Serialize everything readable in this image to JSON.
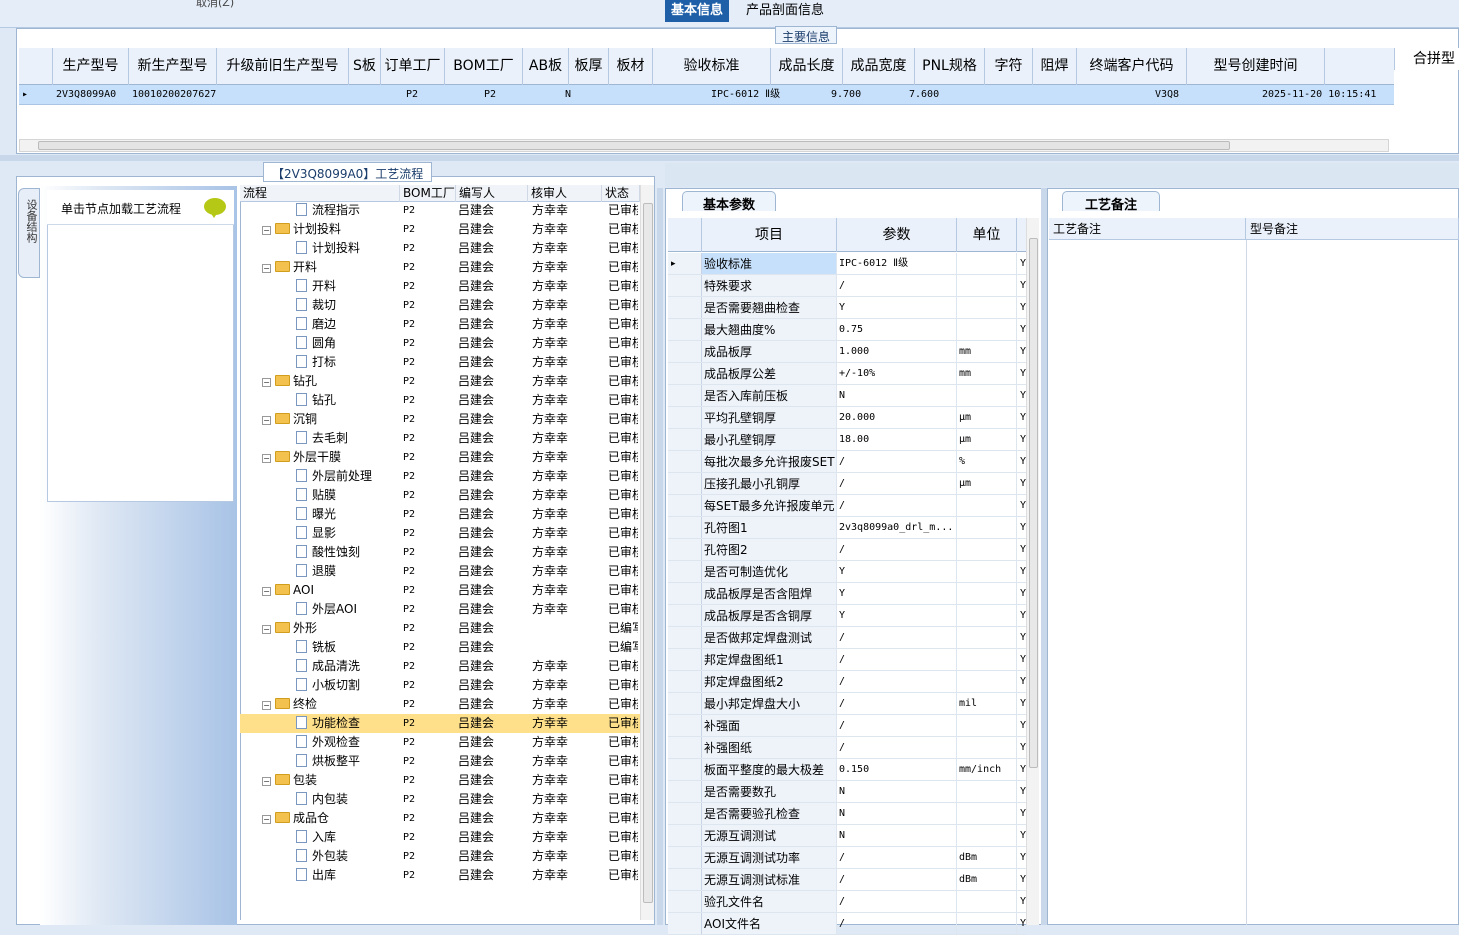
{
  "top": {
    "cut_label": "取消(Z)"
  },
  "main_info": {
    "title": "主要信息",
    "columns": [
      "生产型号",
      "新生产型号",
      "升级前旧生产型号",
      "S板",
      "订单工厂",
      "BOM工厂",
      "AB板",
      "板厚",
      "板材",
      "验收标准",
      "成品长度",
      "成品宽度",
      "PNL规格",
      "字符",
      "阻焊",
      "终端客户代码",
      "型号创建时间"
    ],
    "row": {
      "prod_model": "2V3Q8099A0",
      "new_model": "10010200207627",
      "order_factory": "P2",
      "bom_factory": "P2",
      "ab_board": "N",
      "accept_std": "IPC-6012 Ⅱ级",
      "length": "9.700",
      "width": "7.600",
      "customer_code": "V3Q8",
      "created": "2025-11-20 10:15:41"
    },
    "merge_tab": "合拼型"
  },
  "process": {
    "title": "【2V3Q8099A0】工艺流程",
    "vtab": "设备结构",
    "load_hint": "单击节点加载工艺流程",
    "columns": [
      "流程",
      "BOM工厂",
      "编写人",
      "核审人",
      "状态"
    ],
    "rows": [
      {
        "name": "流程指示",
        "level": 2,
        "bom": "P2",
        "writer": "吕建会",
        "reviewer": "方幸幸",
        "status": "已审核"
      },
      {
        "name": "计划投料",
        "level": 1,
        "bom": "P2",
        "writer": "吕建会",
        "reviewer": "方幸幸",
        "status": "已审核"
      },
      {
        "name": "计划投料",
        "level": 2,
        "bom": "P2",
        "writer": "吕建会",
        "reviewer": "方幸幸",
        "status": "已审核"
      },
      {
        "name": "开料",
        "level": 1,
        "bom": "P2",
        "writer": "吕建会",
        "reviewer": "方幸幸",
        "status": "已审核"
      },
      {
        "name": "开料",
        "level": 2,
        "bom": "P2",
        "writer": "吕建会",
        "reviewer": "方幸幸",
        "status": "已审核"
      },
      {
        "name": "裁切",
        "level": 2,
        "bom": "P2",
        "writer": "吕建会",
        "reviewer": "方幸幸",
        "status": "已审核"
      },
      {
        "name": "磨边",
        "level": 2,
        "bom": "P2",
        "writer": "吕建会",
        "reviewer": "方幸幸",
        "status": "已审核"
      },
      {
        "name": "圆角",
        "level": 2,
        "bom": "P2",
        "writer": "吕建会",
        "reviewer": "方幸幸",
        "status": "已审核"
      },
      {
        "name": "打标",
        "level": 2,
        "bom": "P2",
        "writer": "吕建会",
        "reviewer": "方幸幸",
        "status": "已审核"
      },
      {
        "name": "钻孔",
        "level": 1,
        "bom": "P2",
        "writer": "吕建会",
        "reviewer": "方幸幸",
        "status": "已审核"
      },
      {
        "name": "钻孔",
        "level": 2,
        "bom": "P2",
        "writer": "吕建会",
        "reviewer": "方幸幸",
        "status": "已审核"
      },
      {
        "name": "沉铜",
        "level": 1,
        "bom": "P2",
        "writer": "吕建会",
        "reviewer": "方幸幸",
        "status": "已审核"
      },
      {
        "name": "去毛刺",
        "level": 2,
        "bom": "P2",
        "writer": "吕建会",
        "reviewer": "方幸幸",
        "status": "已审核"
      },
      {
        "name": "外层干膜",
        "level": 1,
        "bom": "P2",
        "writer": "吕建会",
        "reviewer": "方幸幸",
        "status": "已审核"
      },
      {
        "name": "外层前处理",
        "level": 2,
        "bom": "P2",
        "writer": "吕建会",
        "reviewer": "方幸幸",
        "status": "已审核"
      },
      {
        "name": "贴膜",
        "level": 2,
        "bom": "P2",
        "writer": "吕建会",
        "reviewer": "方幸幸",
        "status": "已审核"
      },
      {
        "name": "曝光",
        "level": 2,
        "bom": "P2",
        "writer": "吕建会",
        "reviewer": "方幸幸",
        "status": "已审核"
      },
      {
        "name": "显影",
        "level": 2,
        "bom": "P2",
        "writer": "吕建会",
        "reviewer": "方幸幸",
        "status": "已审核"
      },
      {
        "name": "酸性蚀刻",
        "level": 2,
        "bom": "P2",
        "writer": "吕建会",
        "reviewer": "方幸幸",
        "status": "已审核"
      },
      {
        "name": "退膜",
        "level": 2,
        "bom": "P2",
        "writer": "吕建会",
        "reviewer": "方幸幸",
        "status": "已审核"
      },
      {
        "name": "AOI",
        "level": 1,
        "bom": "P2",
        "writer": "吕建会",
        "reviewer": "方幸幸",
        "status": "已审核"
      },
      {
        "name": "外层AOI",
        "level": 2,
        "bom": "P2",
        "writer": "吕建会",
        "reviewer": "方幸幸",
        "status": "已审核"
      },
      {
        "name": "外形",
        "level": 1,
        "bom": "P2",
        "writer": "吕建会",
        "reviewer": "",
        "status": "已编写"
      },
      {
        "name": "铣板",
        "level": 2,
        "bom": "P2",
        "writer": "吕建会",
        "reviewer": "",
        "status": "已编写"
      },
      {
        "name": "成品清洗",
        "level": 2,
        "bom": "P2",
        "writer": "吕建会",
        "reviewer": "方幸幸",
        "status": "已审核"
      },
      {
        "name": "小板切割",
        "level": 2,
        "bom": "P2",
        "writer": "吕建会",
        "reviewer": "方幸幸",
        "status": "已审核"
      },
      {
        "name": "终检",
        "level": 1,
        "bom": "P2",
        "writer": "吕建会",
        "reviewer": "方幸幸",
        "status": "已审核"
      },
      {
        "name": "功能检查",
        "level": 2,
        "bom": "P2",
        "writer": "吕建会",
        "reviewer": "方幸幸",
        "status": "已审核",
        "selected": true
      },
      {
        "name": "外观检查",
        "level": 2,
        "bom": "P2",
        "writer": "吕建会",
        "reviewer": "方幸幸",
        "status": "已审核"
      },
      {
        "name": "烘板整平",
        "level": 2,
        "bom": "P2",
        "writer": "吕建会",
        "reviewer": "方幸幸",
        "status": "已审核"
      },
      {
        "name": "包装",
        "level": 1,
        "bom": "P2",
        "writer": "吕建会",
        "reviewer": "方幸幸",
        "status": "已审核"
      },
      {
        "name": "内包装",
        "level": 2,
        "bom": "P2",
        "writer": "吕建会",
        "reviewer": "方幸幸",
        "status": "已审核"
      },
      {
        "name": "成品仓",
        "level": 1,
        "bom": "P2",
        "writer": "吕建会",
        "reviewer": "方幸幸",
        "status": "已审核"
      },
      {
        "name": "入库",
        "level": 2,
        "bom": "P2",
        "writer": "吕建会",
        "reviewer": "方幸幸",
        "status": "已审核"
      },
      {
        "name": "外包装",
        "level": 2,
        "bom": "P2",
        "writer": "吕建会",
        "reviewer": "方幸幸",
        "status": "已审核"
      },
      {
        "name": "出库",
        "level": 2,
        "bom": "P2",
        "writer": "吕建会",
        "reviewer": "方幸幸",
        "status": "已审核"
      }
    ]
  },
  "right_tabs": {
    "basic": "基本信息",
    "section": "产品剖面信息"
  },
  "basic_params": {
    "tab": "基本参数",
    "columns": [
      "项目",
      "参数",
      "单位"
    ],
    "rows": [
      {
        "item": "验收标准",
        "param": "IPC-6012 Ⅱ级",
        "unit": "",
        "flag": "Y"
      },
      {
        "item": "特殊要求",
        "param": "/",
        "unit": "",
        "flag": "Y"
      },
      {
        "item": "是否需要翘曲检查",
        "param": "Y",
        "unit": "",
        "flag": "Y"
      },
      {
        "item": "最大翘曲度%",
        "param": "0.75",
        "unit": "",
        "flag": "Y"
      },
      {
        "item": "成品板厚",
        "param": "1.000",
        "unit": "mm",
        "flag": "Y"
      },
      {
        "item": "成品板厚公差",
        "param": "+/-10%",
        "unit": "mm",
        "flag": "Y"
      },
      {
        "item": "是否入库前压板",
        "param": "N",
        "unit": "",
        "flag": "Y"
      },
      {
        "item": "平均孔壁铜厚",
        "param": "20.000",
        "unit": "μm",
        "flag": "Y"
      },
      {
        "item": "最小孔壁铜厚",
        "param": "18.00",
        "unit": "μm",
        "flag": "Y"
      },
      {
        "item": "每批次最多允许报废SET",
        "param": "/",
        "unit": "%",
        "flag": "Y"
      },
      {
        "item": "压接孔最小孔铜厚",
        "param": "/",
        "unit": "μm",
        "flag": "Y"
      },
      {
        "item": "每SET最多允许报废单元",
        "param": "/",
        "unit": "",
        "flag": "Y"
      },
      {
        "item": "孔符图1",
        "param": "2v3q8099a0_drl_m...",
        "unit": "",
        "flag": "Y"
      },
      {
        "item": "孔符图2",
        "param": "/",
        "unit": "",
        "flag": "Y"
      },
      {
        "item": "是否可制造优化",
        "param": "Y",
        "unit": "",
        "flag": "Y"
      },
      {
        "item": "成品板厚是否含阻焊",
        "param": "Y",
        "unit": "",
        "flag": "Y"
      },
      {
        "item": "成品板厚是否含铜厚",
        "param": "Y",
        "unit": "",
        "flag": "Y"
      },
      {
        "item": "是否做邦定焊盘测试",
        "param": "/",
        "unit": "",
        "flag": "Y"
      },
      {
        "item": "邦定焊盘图纸1",
        "param": "/",
        "unit": "",
        "flag": "Y"
      },
      {
        "item": "邦定焊盘图纸2",
        "param": "/",
        "unit": "",
        "flag": "Y"
      },
      {
        "item": "最小邦定焊盘大小",
        "param": "/",
        "unit": "mil",
        "flag": "Y"
      },
      {
        "item": "补强面",
        "param": "/",
        "unit": "",
        "flag": "Y"
      },
      {
        "item": "补强图纸",
        "param": "/",
        "unit": "",
        "flag": "Y"
      },
      {
        "item": "板面平整度的最大极差",
        "param": "0.150",
        "unit": "mm/inch",
        "flag": "Y"
      },
      {
        "item": "是否需要数孔",
        "param": "N",
        "unit": "",
        "flag": "Y"
      },
      {
        "item": "是否需要验孔检查",
        "param": "N",
        "unit": "",
        "flag": "Y"
      },
      {
        "item": "无源互调测试",
        "param": "N",
        "unit": "",
        "flag": "Y"
      },
      {
        "item": "无源互调测试功率",
        "param": "/",
        "unit": "dBm",
        "flag": "Y"
      },
      {
        "item": "无源互调测试标准",
        "param": "/",
        "unit": "dBm",
        "flag": "Y"
      },
      {
        "item": "验孔文件名",
        "param": "/",
        "unit": "",
        "flag": "Y"
      },
      {
        "item": "AOI文件名",
        "param": "/",
        "unit": "",
        "flag": "Y"
      }
    ]
  },
  "remarks": {
    "tab": "工艺备注",
    "col1": "工艺备注",
    "col2": "型号备注"
  }
}
